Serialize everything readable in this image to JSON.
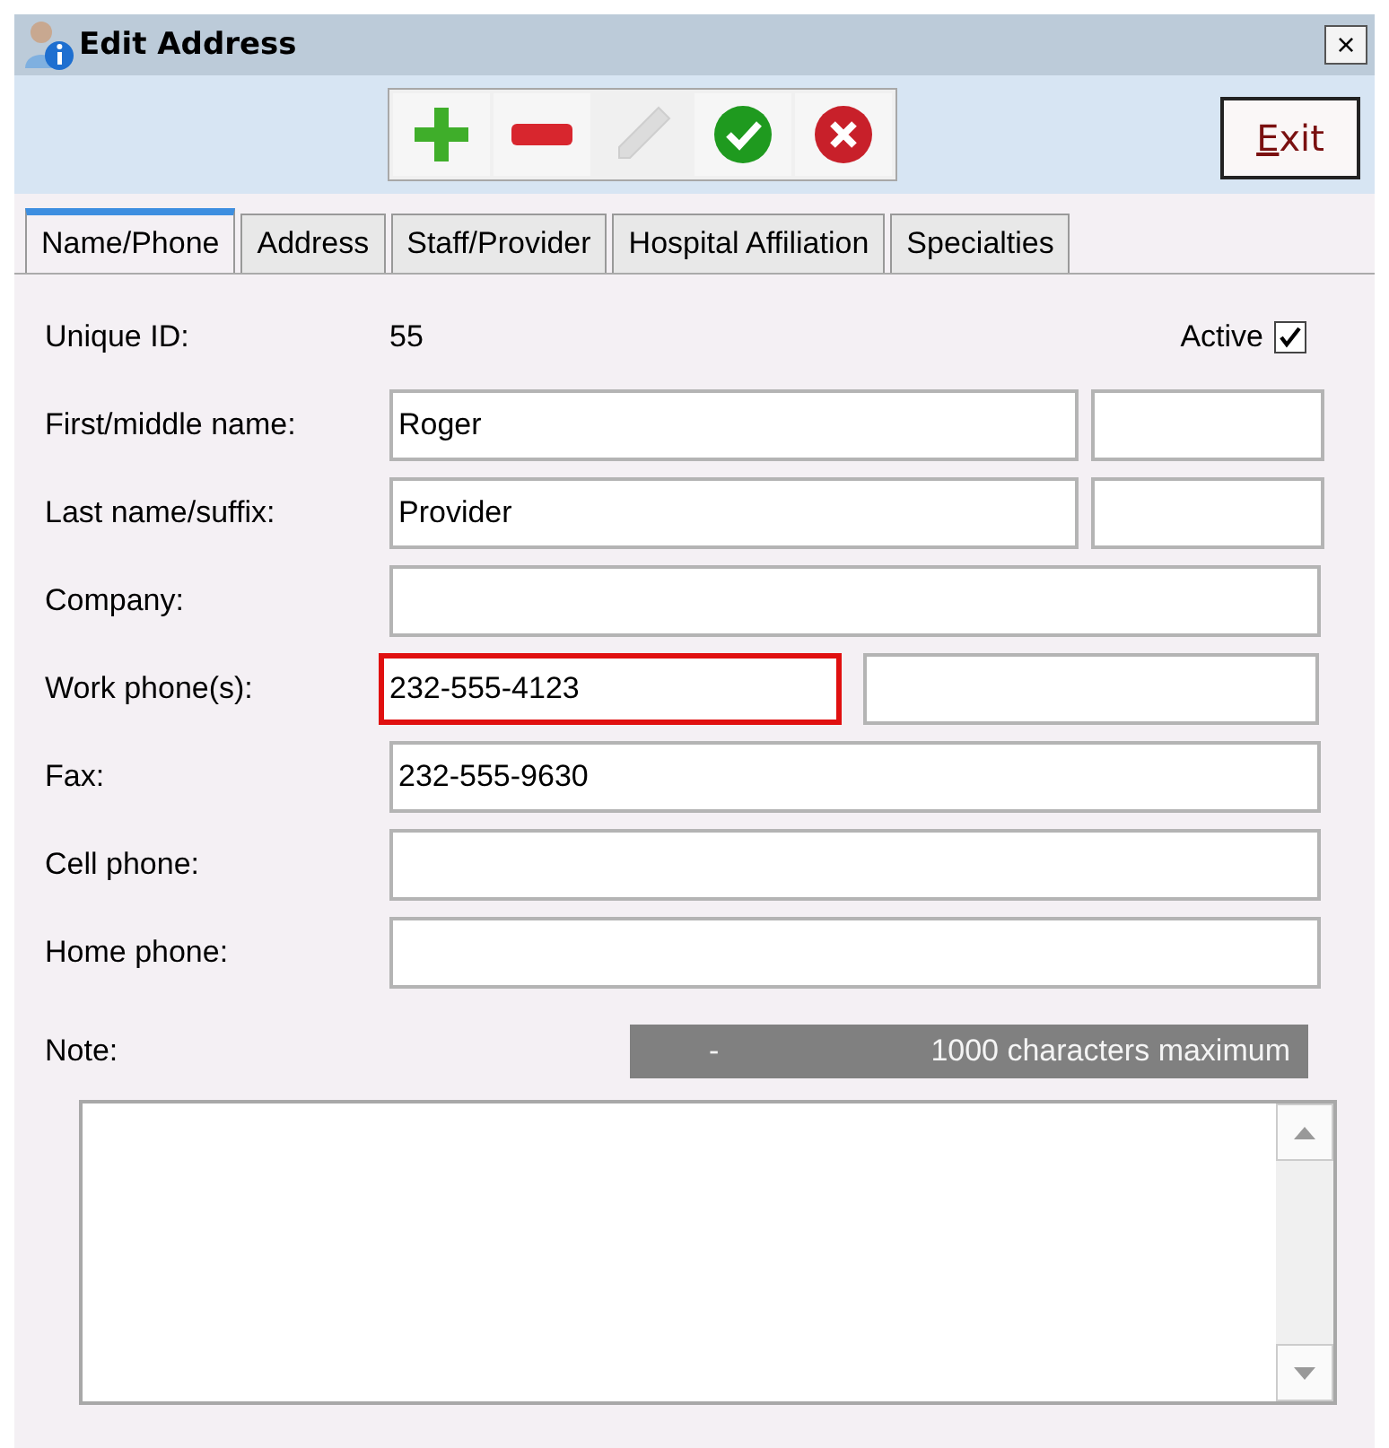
{
  "window": {
    "title": "Edit Address",
    "close": "×"
  },
  "toolbar": {
    "buttons": [
      {
        "kind": "add",
        "disabled": false
      },
      {
        "kind": "remove",
        "disabled": false
      },
      {
        "kind": "edit",
        "disabled": true
      },
      {
        "kind": "confirm",
        "disabled": false
      },
      {
        "kind": "cancel",
        "disabled": false
      }
    ],
    "exit": "Exit"
  },
  "tabs": [
    {
      "label": "Name/Phone",
      "selected": true
    },
    {
      "label": "Address",
      "selected": false
    },
    {
      "label": "Staff/Provider",
      "selected": false
    },
    {
      "label": "Hospital Affiliation",
      "selected": false
    },
    {
      "label": "Specialties",
      "selected": false
    }
  ],
  "unique_id": {
    "label": "Unique ID:",
    "value": "55"
  },
  "active": {
    "label": "Active",
    "checked": true
  },
  "rows": [
    {
      "label": "First/middle name:",
      "kind": "split",
      "fields": [
        {
          "value": "Roger",
          "highlighted": false
        },
        {
          "highlighted": false
        }
      ]
    },
    {
      "label": "Last name/suffix:",
      "kind": "split",
      "fields": [
        {
          "value": "Provider",
          "highlighted": false
        },
        {
          "highlighted": false
        }
      ]
    },
    {
      "label": "Company:",
      "kind": "single",
      "fields": [
        {
          "highlighted": false
        }
      ]
    },
    {
      "label": "Work phone(s):",
      "kind": "half",
      "fields": [
        {
          "value": "232-555-4123",
          "highlighted": true
        },
        {
          "highlighted": false
        }
      ]
    },
    {
      "label": "Fax:",
      "kind": "single",
      "fields": [
        {
          "value": "232-555-9630",
          "highlighted": false
        }
      ]
    },
    {
      "label": "Cell phone:",
      "kind": "single",
      "fields": [
        {
          "highlighted": false
        }
      ]
    },
    {
      "label": "Home phone:",
      "kind": "single",
      "fields": [
        {
          "highlighted": false
        }
      ]
    }
  ],
  "note": {
    "label": "Note:",
    "counter": "-",
    "limit": "1000 characters maximum"
  }
}
